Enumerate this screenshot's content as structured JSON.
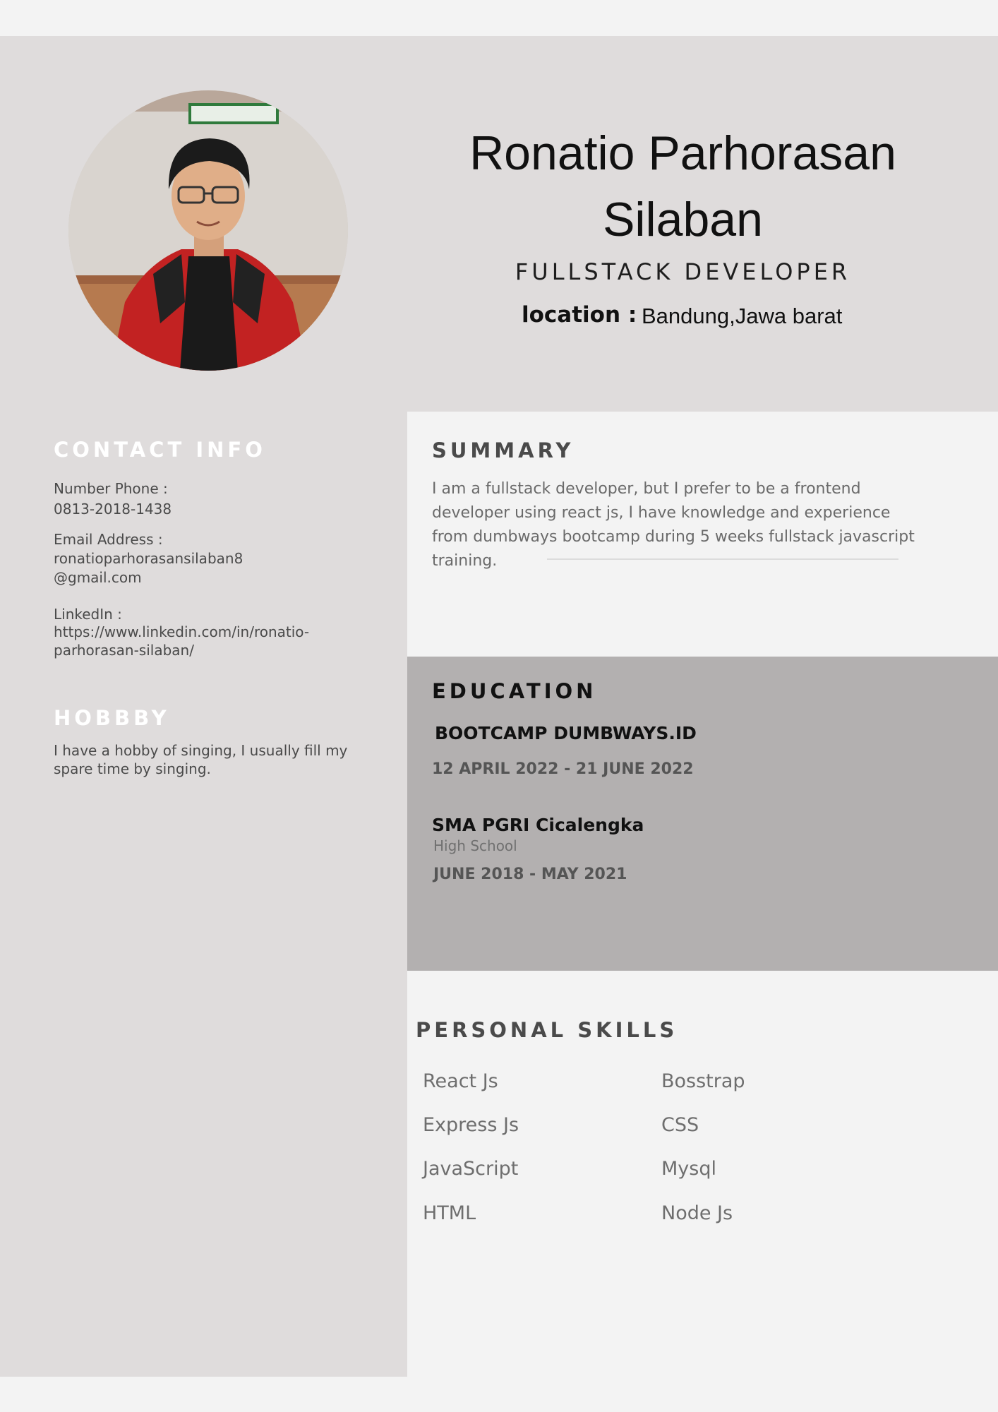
{
  "header": {
    "name_line1": "Ronatio Parhorasan",
    "name_line2": "Silaban",
    "role": "FULLSTACK DEVELOPER",
    "location_label": "location :",
    "location_value": "Bandung,Jawa barat"
  },
  "contact": {
    "title": "CONTACT INFO",
    "phone_label": "Number Phone :",
    "phone_value": "0813-2018-1438",
    "email_label": "Email Address :",
    "email_value_line1": "ronatioparhorasansilaban8",
    "email_value_line2": "@gmail.com",
    "linkedin_label": "LinkedIn :",
    "linkedin_value_line1": "https://www.linkedin.com/in/ronatio-",
    "linkedin_value_line2": "parhorasan-silaban/"
  },
  "hobby": {
    "title": "HOBBBY",
    "text_line1": "I have a hobby of singing, I usually fill my",
    "text_line2": "spare time by singing."
  },
  "summary": {
    "title": "SUMMARY",
    "lines": [
      "I am a fullstack developer, but I prefer to be a frontend",
      "developer using react js, I have knowledge and experience",
      "from dumbways bootcamp during 5 weeks fullstack javascript",
      "training."
    ]
  },
  "education": {
    "title": "EDUCATION",
    "items": [
      {
        "school": "BOOTCAMP DUMBWAYS.ID",
        "date": "12 APRIL 2022 - 21 JUNE 2022"
      },
      {
        "school": "SMA PGRI Cicalengka",
        "level": "High School",
        "date": "JUNE 2018 - MAY 2021"
      }
    ]
  },
  "skills": {
    "title": "PERSONAL SKILLS",
    "column1": [
      "React Js",
      "Express Js",
      "JavaScript",
      "HTML"
    ],
    "column2": [
      "Bosstrap",
      "CSS",
      "Mysql",
      "Node Js"
    ]
  },
  "colors": {
    "band": "#dfdcdc",
    "page": "#f3f3f3",
    "education_panel": "#b3b0b0"
  }
}
